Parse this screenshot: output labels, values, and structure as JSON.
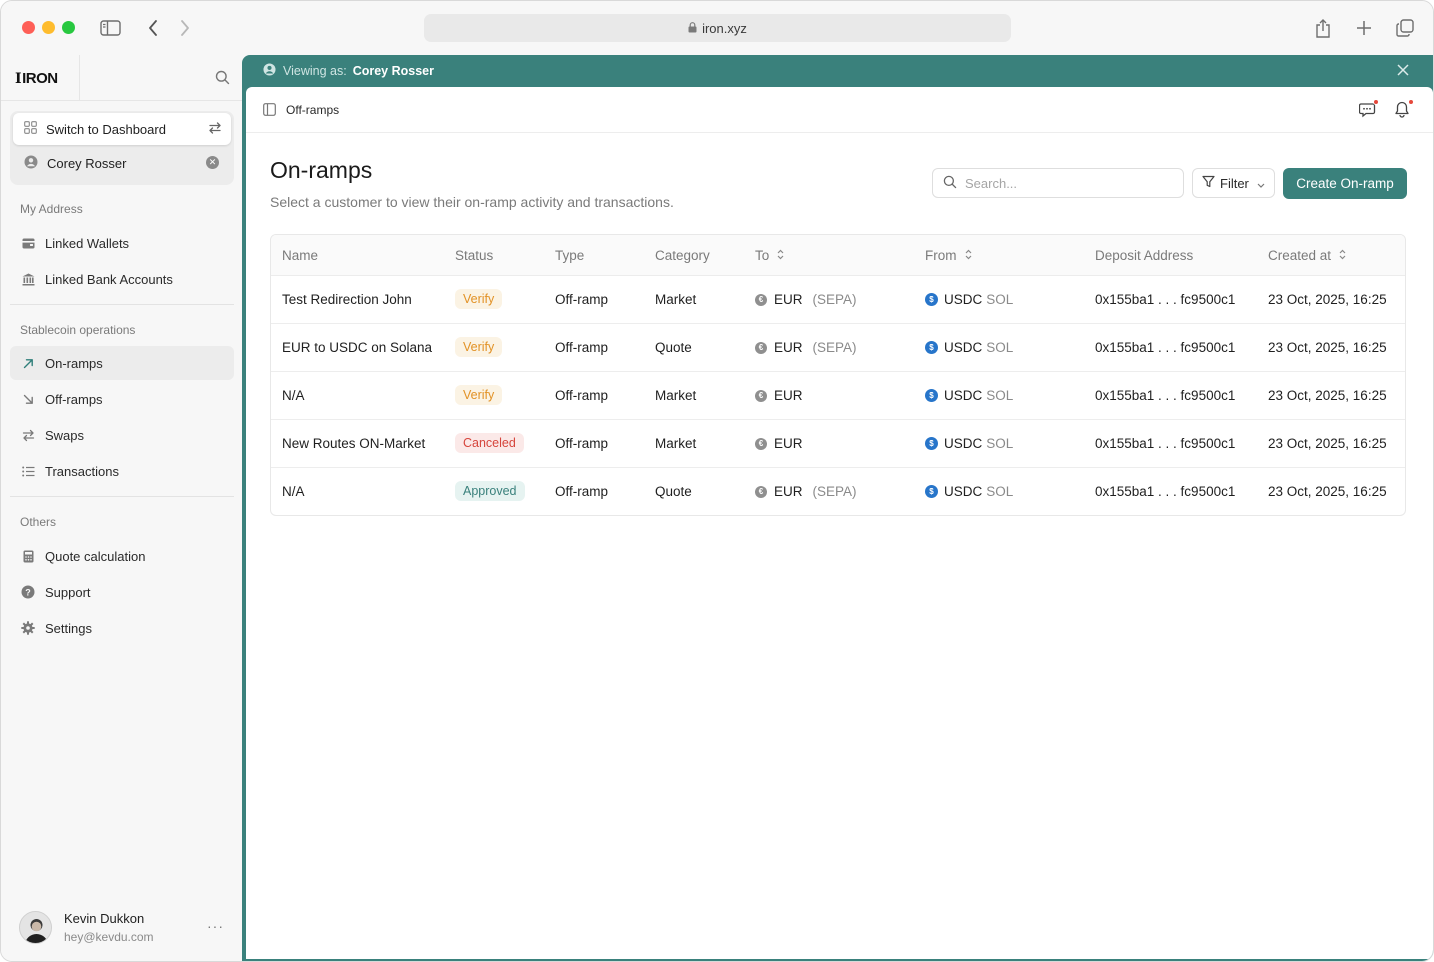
{
  "browser": {
    "url": "iron.xyz"
  },
  "brand": {
    "logo_text": "IRON",
    "accent": "#3a817c"
  },
  "sidebar": {
    "switch_label": "Switch to Dashboard",
    "viewing_user": "Corey Rosser",
    "sections": [
      {
        "label": "My Address",
        "items": [
          {
            "label": "Linked Wallets",
            "icon": "wallet-icon"
          },
          {
            "label": "Linked Bank Accounts",
            "icon": "bank-icon"
          }
        ]
      },
      {
        "label": "Stablecoin operations",
        "items": [
          {
            "label": "On-ramps",
            "icon": "arrow-up-right-icon",
            "active": true
          },
          {
            "label": "Off-ramps",
            "icon": "arrow-down-right-icon"
          },
          {
            "label": "Swaps",
            "icon": "swap-icon"
          },
          {
            "label": "Transactions",
            "icon": "list-icon"
          }
        ]
      },
      {
        "label": "Others",
        "items": [
          {
            "label": "Quote calculation",
            "icon": "calculator-icon"
          },
          {
            "label": "Support",
            "icon": "help-icon"
          },
          {
            "label": "Settings",
            "icon": "gear-icon"
          }
        ]
      }
    ],
    "profile": {
      "name": "Kevin Dukkon",
      "email": "hey@kevdu.com"
    }
  },
  "banner": {
    "key": "Viewing as:",
    "value": "Corey Rosser"
  },
  "breadcrumb": "Off-ramps",
  "page": {
    "title": "On-ramps",
    "subtitle": "Select a customer to view their on-ramp activity and transactions.",
    "search_placeholder": "Search...",
    "filter_label": "Filter",
    "create_label": "Create On-ramp"
  },
  "table": {
    "columns": [
      "Name",
      "Status",
      "Type",
      "Category",
      "To",
      "From",
      "Deposit Address",
      "Created at"
    ],
    "rows": [
      {
        "name": "Test Redirection John",
        "status": "Verify",
        "type": "Off-ramp",
        "category": "Market",
        "to": "EUR",
        "to_rail": "(SEPA)",
        "from": "USDC",
        "from_chain": "SOL",
        "deposit": "0x155ba1 . . . fc9500c1",
        "created": "23 Oct, 2025, 16:25"
      },
      {
        "name": "EUR to USDC on Solana",
        "status": "Verify",
        "type": "Off-ramp",
        "category": "Quote",
        "to": "EUR",
        "to_rail": "(SEPA)",
        "from": "USDC",
        "from_chain": "SOL",
        "deposit": "0x155ba1 . . . fc9500c1",
        "created": "23 Oct, 2025, 16:25"
      },
      {
        "name": "N/A",
        "status": "Verify",
        "type": "Off-ramp",
        "category": "Market",
        "to": "EUR",
        "to_rail": "",
        "from": "USDC",
        "from_chain": "SOL",
        "deposit": "0x155ba1 . . . fc9500c1",
        "created": "23 Oct, 2025, 16:25"
      },
      {
        "name": "New Routes ON-Market",
        "status": "Canceled",
        "type": "Off-ramp",
        "category": "Market",
        "to": "EUR",
        "to_rail": "",
        "from": "USDC",
        "from_chain": "SOL",
        "deposit": "0x155ba1 . . . fc9500c1",
        "created": "23 Oct, 2025, 16:25"
      },
      {
        "name": "N/A",
        "status": "Approved",
        "type": "Off-ramp",
        "category": "Quote",
        "to": "EUR",
        "to_rail": "(SEPA)",
        "from": "USDC",
        "from_chain": "SOL",
        "deposit": "0x155ba1 . . . fc9500c1",
        "created": "23 Oct, 2025, 16:25"
      }
    ]
  }
}
